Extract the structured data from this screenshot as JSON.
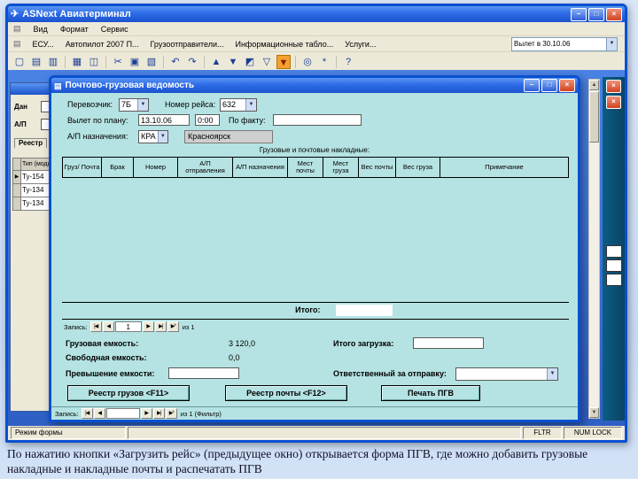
{
  "ui": {
    "plane": "✈",
    "doc": "▤",
    "min": "–",
    "max": "□",
    "close": "×",
    "arrow": "▼",
    "up": "▲",
    "down": "▼",
    "selector": "▶",
    "nav": {
      "first": "|◀",
      "prev": "◀",
      "next": "▶",
      "last": "▶|",
      "new_rec": "▶*"
    }
  },
  "window": {
    "title": "ASNext Авиатерминал",
    "menu": [
      "Вид",
      "Формат",
      "Сервис"
    ],
    "nav_items": [
      "ЕСУ...",
      "Автопилот 2007 П...",
      "Грузоотправители...",
      "Информационные табло...",
      "Услуги..."
    ],
    "flight_selector": "Вылет в 30.10.06",
    "status": {
      "mode": "Режим формы",
      "fltr": "FLTR",
      "num": "NUM LOCK"
    }
  },
  "toolbar_icons": [
    {
      "name": "new",
      "glyph": "▢"
    },
    {
      "name": "open",
      "glyph": "▤"
    },
    {
      "name": "save",
      "glyph": "▥"
    },
    {
      "name": "print",
      "glyph": "▦"
    },
    {
      "name": "print-preview",
      "glyph": "◫"
    },
    {
      "name": "cut",
      "glyph": "✂"
    },
    {
      "name": "copy",
      "glyph": "▣"
    },
    {
      "name": "paste",
      "glyph": "▧"
    },
    {
      "name": "undo",
      "glyph": "↶"
    },
    {
      "name": "redo",
      "glyph": "↷"
    },
    {
      "name": "sort-asc",
      "glyph": "▲"
    },
    {
      "name": "sort-desc",
      "glyph": "▼"
    },
    {
      "name": "filter-by-selection",
      "glyph": "◩"
    },
    {
      "name": "filter-by-form",
      "glyph": "▽"
    },
    {
      "name": "apply-filter",
      "glyph": "▼"
    },
    {
      "name": "find",
      "glyph": "◎"
    },
    {
      "name": "new-record",
      "glyph": "*"
    },
    {
      "name": "help",
      "glyph": "?"
    }
  ],
  "left_window": {
    "field1": "Дан",
    "field2": "А/П",
    "tab": "Реестр",
    "col": "Тип (моди",
    "rows": [
      "Ту-154",
      "Ту-134",
      "Ту-134"
    ]
  },
  "dialog": {
    "title": "Почтово-грузовая ведомость",
    "carrier_label": "Перевозчик:",
    "carrier_value": "7Б",
    "flight_label": "Номер рейса:",
    "flight_value": "632",
    "plan_label": "Вылет по плану:",
    "plan_date": "13.10.06",
    "plan_time": "0:00",
    "fact_label": "По факту:",
    "dest_label": "А/П назначения:",
    "dest_code": "КРА",
    "dest_name": "Красноярск",
    "table_caption": "Грузовые и почтовые накладные:",
    "headers": [
      "Груз/ Почта",
      "Брак",
      "Номер",
      "А/П отправления",
      "А/П назначения",
      "Мест почты",
      "Мест груза",
      "Вес почты",
      "Вес груза",
      "Примечание"
    ],
    "total_label": "Итого:",
    "nav_label": "Запись:",
    "nav_pos": "1",
    "nav_of": "из 1",
    "nav_pos_bottom": "",
    "nav_of_filtered": "из 1 (Фильтр)",
    "cargo_capacity_label": "Грузовая емкость:",
    "cargo_capacity_value": "3 120,0",
    "free_capacity_label": "Свободная емкость:",
    "free_capacity_value": "0,0",
    "excess_label": "Превышение емкости:",
    "total_load_label": "Итого загрузка:",
    "responsible_label": "Ответственный за отправку:",
    "buttons": [
      "Реестр грузов <F11>",
      "Реестр почты <F12>",
      "Печать ПГВ"
    ]
  },
  "caption": {
    "line1": "По нажатию кнопки «Загрузить рейс» (предыдущее окно) открывается форма ПГВ, где можно добавить грузовые",
    "line2": "накладные и накладные почты и распечатать ПГВ"
  }
}
